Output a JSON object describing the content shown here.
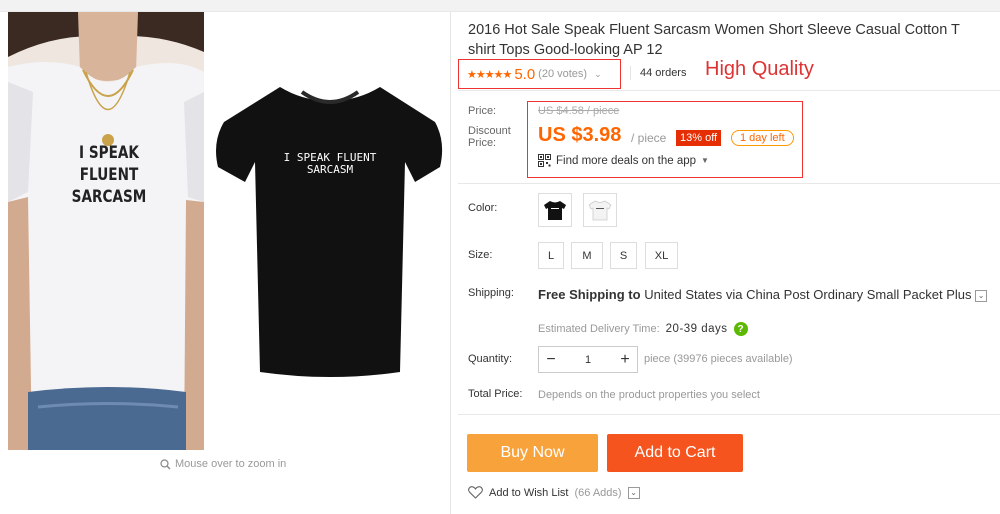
{
  "gallery": {
    "shirt_text_line1": "I SPEAK FLUENT",
    "shirt_text_line2": "SARCASM",
    "zoom_hint": "Mouse over to zoom in"
  },
  "product": {
    "title": "2016 Hot Sale Speak Fluent Sarcasm Women Short Sleeve Casual Cotton T shirt Tops Good-looking AP 12",
    "stars": "★★★★★",
    "rating": "5.0",
    "votes": "(20 votes)",
    "orders": "44 orders",
    "annotation": "High Quality"
  },
  "price": {
    "price_label": "Price:",
    "original": "US $4.58 / piece",
    "discount_label_1": "Discount",
    "discount_label_2": "Price:",
    "current": "US $3.98",
    "per_piece": "/ piece",
    "discount_badge": "13% off",
    "time_left": "1 day left",
    "app_deals": "Find more deals on the app"
  },
  "properties": {
    "color_label": "Color:",
    "size_label": "Size:",
    "sizes": [
      "L",
      "M",
      "S",
      "XL"
    ],
    "shipping_label": "Shipping:",
    "shipping_bold": "Free Shipping to",
    "shipping_rest": "United States via China Post Ordinary Small Packet Plus",
    "est_label": "Estimated Delivery Time:",
    "est_days": "20-39 days",
    "quantity_label": "Quantity:",
    "quantity_value": "1",
    "quantity_note": "piece (39976 pieces available)",
    "total_label": "Total Price:",
    "total_note": "Depends on the product properties you select"
  },
  "actions": {
    "buy_now": "Buy Now",
    "add_to_cart": "Add to Cart",
    "wish_list": "Add to Wish List",
    "wish_count": "(66 Adds)"
  },
  "colors": {
    "price_orange": "#f60",
    "buy_button": "#f7a23b",
    "cart_button": "#f5541f",
    "annotation_red": "#e33"
  }
}
